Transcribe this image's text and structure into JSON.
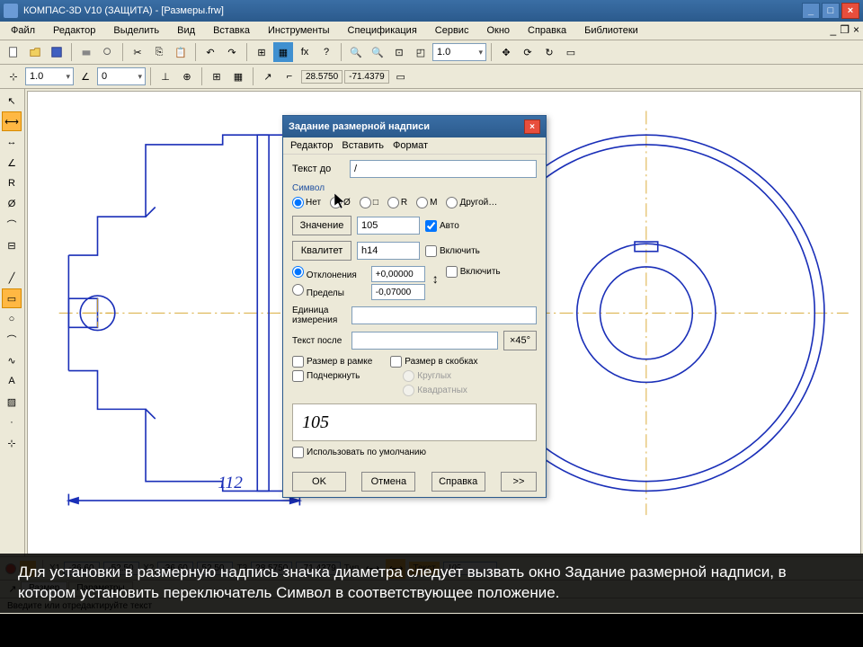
{
  "app": {
    "title": "КОМПАС-3D V10 (ЗАЩИТА) - [Размеры.frw]"
  },
  "menubar": [
    "Файл",
    "Редактор",
    "Выделить",
    "Вид",
    "Вставка",
    "Инструменты",
    "Спецификация",
    "Сервис",
    "Окно",
    "Справка",
    "Библиотеки"
  ],
  "toolbar2": {
    "zoom_combo": "1.0",
    "angle_combo": "0",
    "coord_x": "28.5750",
    "coord_y": "-71.4379",
    "zoom_value": "1.0"
  },
  "dialog": {
    "title": "Задание размерной надписи",
    "menu": [
      "Редактор",
      "Вставить",
      "Формат"
    ],
    "text_before_label": "Текст до",
    "text_before_value": "/",
    "symbol_group": "Символ",
    "sym_none": "Нет",
    "sym_diam": "Ø",
    "sym_square": "□",
    "sym_r": "R",
    "sym_m": "M",
    "sym_other": "Другой…",
    "value_btn": "Значение",
    "value_input": "105",
    "auto_chk": "Авто",
    "qualifier_btn": "Квалитет",
    "qualifier_input": "h14",
    "include_chk": "Включить",
    "deviations": "Отклонения",
    "limits": "Пределы",
    "tol_upper": "+0,00000",
    "tol_lower": "-0,07000",
    "include2_chk": "Включить",
    "unit_label": "Единица измерения",
    "text_after_label": "Текст после",
    "x45_btn": "×45°",
    "brackets_chk": "Размер в скобках",
    "brackets_round": "Круглых",
    "brackets_square": "Квадратных",
    "frame_chk": "Размер в рамке",
    "underline_chk": "Подчеркнуть",
    "preview_value": "105",
    "default_chk": "Использовать по умолчанию",
    "ok": "OK",
    "cancel": "Отмена",
    "help": "Справка",
    "more": ">>"
  },
  "propbar": {
    "x1_label": "X1",
    "x1": "-36.60",
    "y1": "-52.50",
    "x2_label": "X2",
    "x2": "-36.60",
    "y2": "52.50",
    "t3_label": "T3",
    "t3a": "28.5750",
    "t3b": "-71.4379",
    "type_label": "Тип",
    "text_label": "Текст",
    "text_value": "105"
  },
  "tabs": {
    "t1": "Размер",
    "t2": "Параметры"
  },
  "statusbar": "Введите или отредактируйте текст",
  "drawing": {
    "dim_value": "112"
  },
  "subtitle": "Для установки в размерную надпись значка диаметра следует вызвать окно Задание размерной надписи, в котором установить переключатель Символ в соответствующее положение."
}
